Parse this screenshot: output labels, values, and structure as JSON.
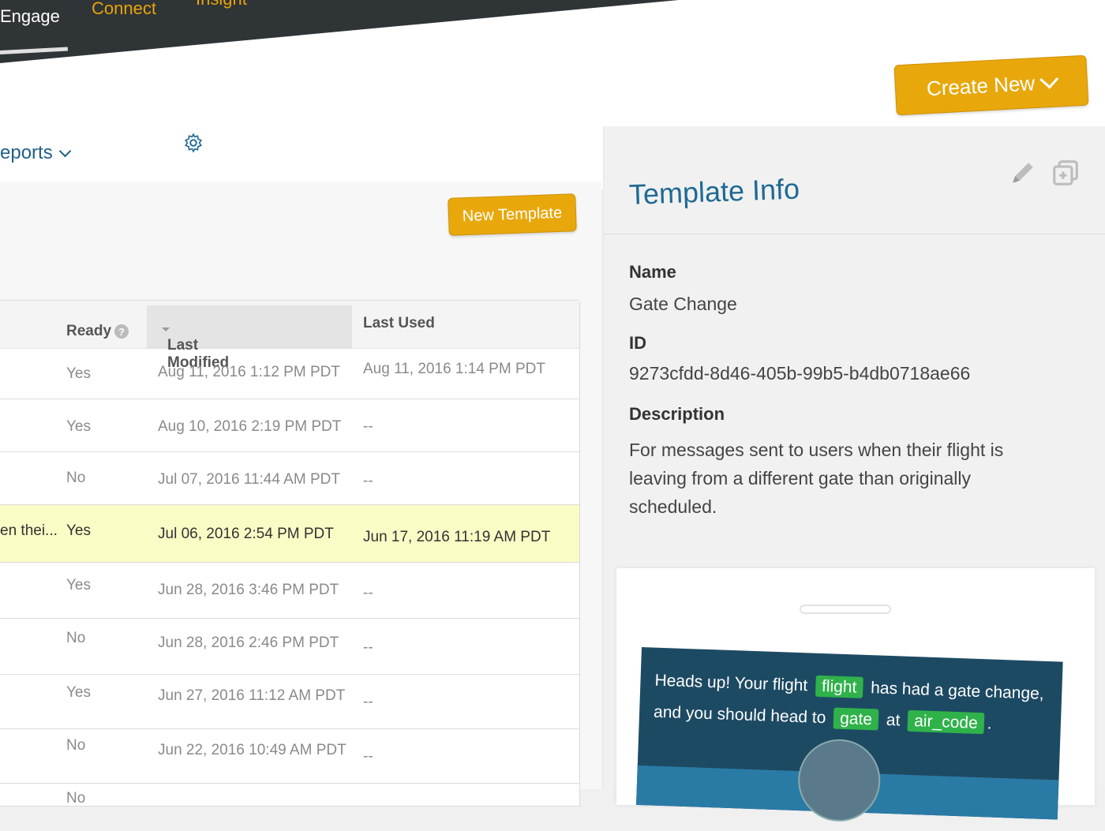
{
  "nav": {
    "items": [
      "Engage",
      "Connect",
      "Insight"
    ]
  },
  "toolbar": {
    "create_new_label": "Create New",
    "reports_label": "eports",
    "new_template_label": "New Template"
  },
  "table": {
    "headers": {
      "ready": "Ready",
      "last_modified": "Last Modified",
      "last_used": "Last Used"
    },
    "rows": [
      {
        "name": "",
        "ready": "Yes",
        "modified": "Aug 11, 2016 1:12 PM PDT",
        "used": "Aug 11, 2016 1:14 PM PDT"
      },
      {
        "name": "",
        "ready": "Yes",
        "modified": "Aug 10, 2016 2:19 PM PDT",
        "used": "--"
      },
      {
        "name": "",
        "ready": "No",
        "modified": "Jul 07, 2016 11:44 AM PDT",
        "used": "--"
      },
      {
        "name": "en thei...",
        "ready": "Yes",
        "modified": "Jul 06, 2016 2:54 PM PDT",
        "used": "Jun 17, 2016 11:19 AM PDT"
      },
      {
        "name": "",
        "ready": "Yes",
        "modified": "Jun 28, 2016 3:46 PM PDT",
        "used": "--"
      },
      {
        "name": "",
        "ready": "No",
        "modified": "Jun 28, 2016 2:46 PM PDT",
        "used": "--"
      },
      {
        "name": "",
        "ready": "Yes",
        "modified": "Jun 27, 2016 11:12 AM PDT",
        "used": "--"
      },
      {
        "name": "",
        "ready": "No",
        "modified": "Jun 22, 2016 10:49 AM PDT",
        "used": "--"
      },
      {
        "name": "",
        "ready": "No",
        "modified": "",
        "used": ""
      }
    ]
  },
  "info": {
    "title": "Template Info",
    "name_label": "Name",
    "name_value": "Gate Change",
    "id_label": "ID",
    "id_value": "9273cfdd-8d46-405b-99b5-b4db0718ae66",
    "desc_label": "Description",
    "desc_value": "For messages sent to users when their flight is leaving from a different gate than originally scheduled."
  },
  "preview": {
    "text_1": "Heads up! Your flight",
    "tag_flight": "flight",
    "text_2": "has had a gate change, and you should head to",
    "tag_gate": "gate",
    "text_3": "at",
    "tag_air_code": "air_code",
    "text_4": "."
  },
  "colors": {
    "accent": "#e8a80c",
    "nav_bg": "#2f3436",
    "link": "#1f6a93",
    "highlight_row": "#fafcc5",
    "tag": "#2fb24a"
  }
}
